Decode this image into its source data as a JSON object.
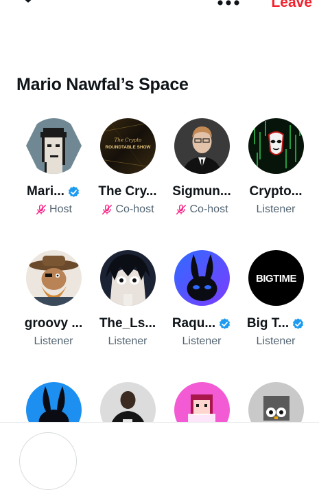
{
  "header": {
    "leave_label": "Leave"
  },
  "space": {
    "title": "Mario Nawfal’s Space"
  },
  "participants": [
    {
      "name": "Mari...",
      "role": "Host",
      "verified": true,
      "muted_mic": true
    },
    {
      "name": "The Cry...",
      "role": "Co-host",
      "verified": false,
      "muted_mic": true
    },
    {
      "name": "Sigmun...",
      "role": "Co-host",
      "verified": false,
      "muted_mic": true
    },
    {
      "name": "Crypto...",
      "role": "Listener",
      "verified": false,
      "muted_mic": false
    },
    {
      "name": "groovy ...",
      "role": "Listener",
      "verified": false,
      "muted_mic": false
    },
    {
      "name": "The_Ls...",
      "role": "Listener",
      "verified": false,
      "muted_mic": false
    },
    {
      "name": "Raqu...",
      "role": "Listener",
      "verified": true,
      "muted_mic": false
    },
    {
      "name": "Big T...",
      "role": "Listener",
      "verified": true,
      "muted_mic": false
    }
  ],
  "avatar_texts": {
    "roundtable": "ROUNDTABLE SHOW",
    "roundtable_script": "The Crypto",
    "bigtime": "BIGTIME"
  },
  "colors": {
    "accent_red": "#f4212e",
    "verified_blue": "#1d9bf0",
    "mic_pink": "#f91880",
    "secondary_text": "#536471"
  },
  "icons": [
    "chevron-down-icon",
    "more-icon",
    "verified-icon",
    "mic-off-icon"
  ]
}
